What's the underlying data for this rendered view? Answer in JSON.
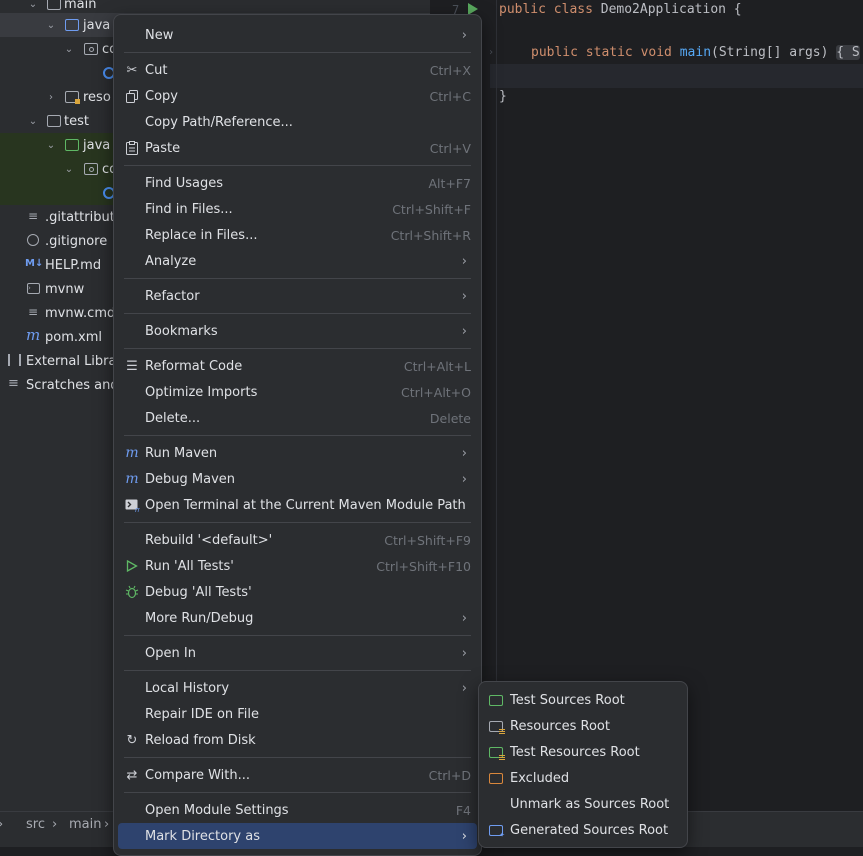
{
  "tree": {
    "items": [
      {
        "label": "main"
      },
      {
        "label": "java"
      },
      {
        "label": "co"
      },
      {
        "label": ""
      },
      {
        "label": "reso"
      },
      {
        "label": "test"
      },
      {
        "label": "java"
      },
      {
        "label": "co"
      },
      {
        "label": ""
      },
      {
        "label": ".gitattribut"
      },
      {
        "label": ".gitignore"
      },
      {
        "label": "HELP.md"
      },
      {
        "label": "mvnw"
      },
      {
        "label": "mvnw.cmd"
      },
      {
        "label": "pom.xml"
      },
      {
        "label": "External Libra"
      },
      {
        "label": "Scratches and"
      }
    ],
    "md_badge": "M↓",
    "pom_badge": "m"
  },
  "editor": {
    "line_number": "7",
    "line1_kw": "public class ",
    "line1_name": "Demo2Application {",
    "line2_kw": "public static void ",
    "line2_fn": "main",
    "line2_rest": "(String[] args) ",
    "line2_fold": "{ S",
    "line3": "}"
  },
  "breadcrumb": {
    "items": [
      "src",
      "main"
    ],
    "separator": "›"
  },
  "menu": {
    "new": {
      "label": "New"
    },
    "cut": {
      "label": "Cut",
      "shortcut": "Ctrl+X"
    },
    "copy": {
      "label": "Copy",
      "shortcut": "Ctrl+C"
    },
    "copy_path": {
      "label": "Copy Path/Reference..."
    },
    "paste": {
      "label": "Paste",
      "shortcut": "Ctrl+V"
    },
    "find_usages": {
      "label": "Find Usages",
      "shortcut": "Alt+F7"
    },
    "find_in_files": {
      "label": "Find in Files...",
      "shortcut": "Ctrl+Shift+F"
    },
    "replace_in_files": {
      "label": "Replace in Files...",
      "shortcut": "Ctrl+Shift+R"
    },
    "analyze": {
      "label": "Analyze"
    },
    "refactor": {
      "label": "Refactor"
    },
    "bookmarks": {
      "label": "Bookmarks"
    },
    "reformat": {
      "label": "Reformat Code",
      "shortcut": "Ctrl+Alt+L"
    },
    "optimize": {
      "label": "Optimize Imports",
      "shortcut": "Ctrl+Alt+O"
    },
    "delete": {
      "label": "Delete...",
      "shortcut": "Delete"
    },
    "run_maven": {
      "label": "Run Maven"
    },
    "debug_maven": {
      "label": "Debug Maven"
    },
    "open_terminal": {
      "label": "Open Terminal at the Current Maven Module Path"
    },
    "rebuild": {
      "label": "Rebuild '<default>'",
      "shortcut": "Ctrl+Shift+F9"
    },
    "run_tests": {
      "label": "Run 'All Tests'",
      "shortcut": "Ctrl+Shift+F10"
    },
    "debug_tests": {
      "label": "Debug 'All Tests'"
    },
    "more_run": {
      "label": "More Run/Debug"
    },
    "open_in": {
      "label": "Open In"
    },
    "local_history": {
      "label": "Local History"
    },
    "repair_ide": {
      "label": "Repair IDE on File"
    },
    "reload": {
      "label": "Reload from Disk"
    },
    "compare": {
      "label": "Compare With...",
      "shortcut": "Ctrl+D"
    },
    "module_settings": {
      "label": "Open Module Settings",
      "shortcut": "F4"
    },
    "mark_dir": {
      "label": "Mark Directory as"
    }
  },
  "submenu": {
    "items": [
      {
        "label": "Test Sources Root",
        "color": "#5fb865"
      },
      {
        "label": "Resources Root",
        "color": "#a6aab2"
      },
      {
        "label": "Test Resources Root",
        "color": "#5fb865"
      },
      {
        "label": "Excluded",
        "color": "#d9873c"
      },
      {
        "label": "Unmark as Sources Root",
        "color": ""
      },
      {
        "label": "Generated Sources Root",
        "color": "#6f9cf0"
      }
    ]
  },
  "colors": {
    "accent_selection": "#2e436e",
    "menu_bg": "#2b2d30",
    "editor_bg": "#1e1f22"
  }
}
